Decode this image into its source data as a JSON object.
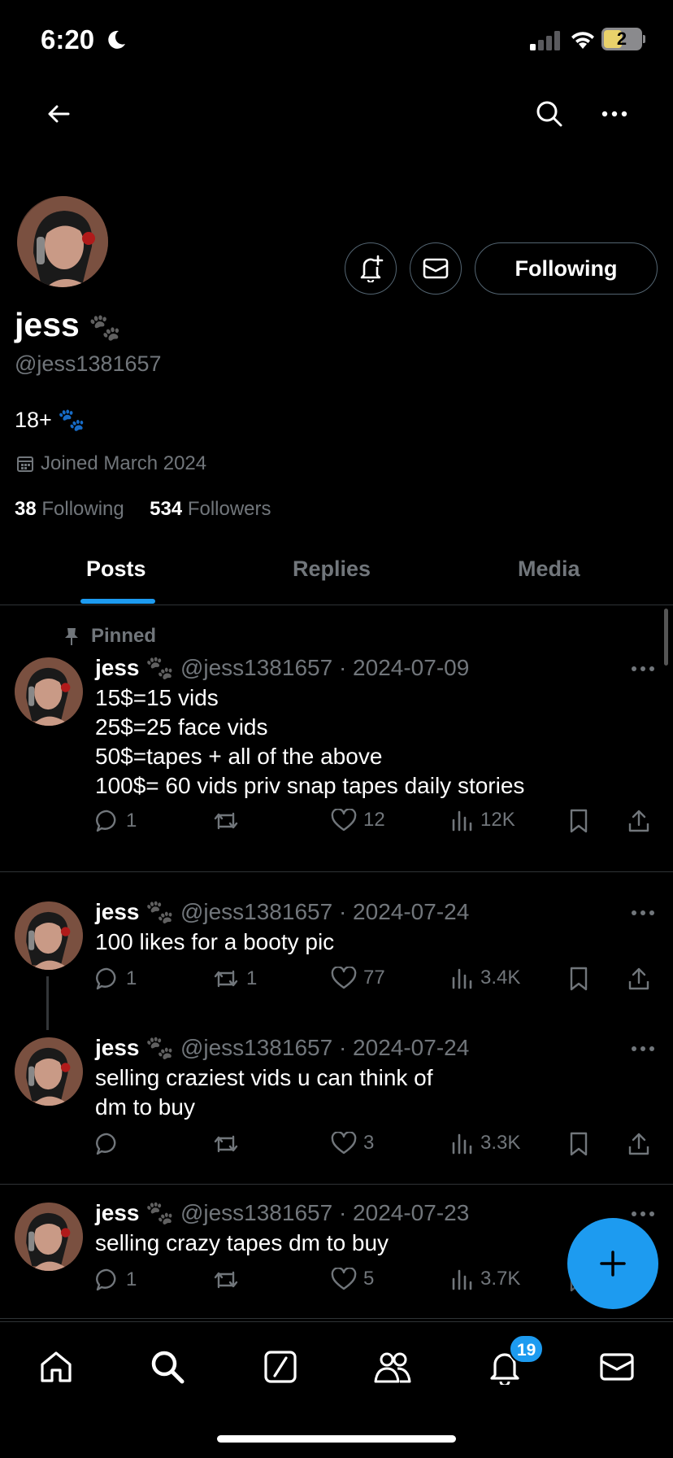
{
  "status_bar": {
    "time": "6:20",
    "battery": "2"
  },
  "profile": {
    "name": "jess",
    "name_emoji": "🐾",
    "handle": "@jess1381657",
    "bio": "18+ 🐾",
    "joined": "Joined March 2024",
    "following_count": "38",
    "following_label": "Following",
    "followers_count": "534",
    "followers_label": "Followers",
    "follow_button": "Following"
  },
  "tabs": [
    {
      "label": "Posts",
      "active": true
    },
    {
      "label": "Replies",
      "active": false
    },
    {
      "label": "Media",
      "active": false
    }
  ],
  "pinned_label": "Pinned",
  "posts": [
    {
      "name": "jess",
      "handle": "@jess1381657",
      "date": "· 2024-07-09",
      "lines": [
        "15$=15 vids",
        "25$=25 face vids",
        "50$=tapes + all of the above",
        "100$= 60 vids priv snap tapes daily stories"
      ],
      "replies": "1",
      "reposts": "",
      "likes": "12",
      "views": "12K"
    },
    {
      "name": "jess",
      "handle": "@jess1381657",
      "date": "· 2024-07-24",
      "lines": [
        "100 likes for a booty pic"
      ],
      "replies": "1",
      "reposts": "1",
      "likes": "77",
      "views": "3.4K"
    },
    {
      "name": "jess",
      "handle": "@jess1381657",
      "date": "· 2024-07-24",
      "lines": [
        "selling craziest vids u can think of",
        "dm to buy"
      ],
      "replies": "",
      "reposts": "",
      "likes": "3",
      "views": "3.3K"
    },
    {
      "name": "jess",
      "handle": "@jess1381657",
      "date": "· 2024-07-23",
      "lines": [
        "selling crazy tapes dm to buy"
      ],
      "replies": "1",
      "reposts": "",
      "likes": "5",
      "views": "3.7K"
    }
  ],
  "notifications_badge": "19",
  "colors": {
    "accent": "#1d9bf0",
    "background": "#000000",
    "muted": "#71767b"
  }
}
